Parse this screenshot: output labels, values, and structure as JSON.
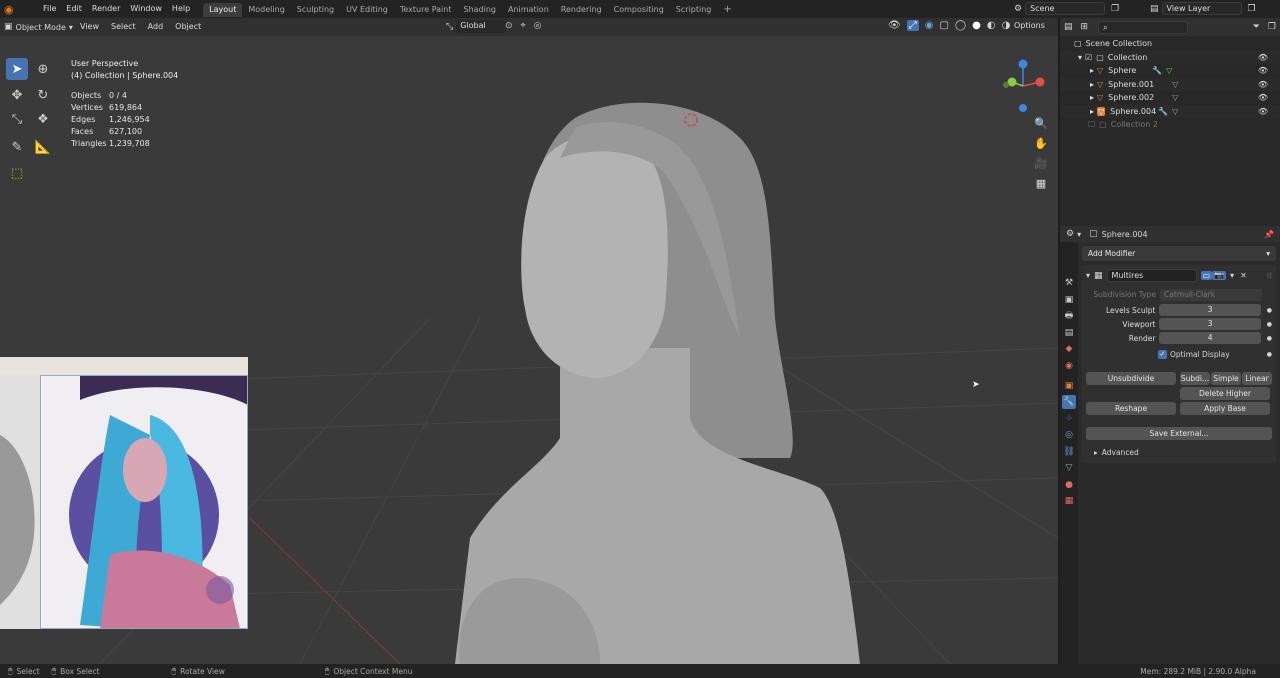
{
  "topbar": {
    "menus": [
      "File",
      "Edit",
      "Render",
      "Window",
      "Help"
    ],
    "workspaces": [
      "Layout",
      "Modeling",
      "Sculpting",
      "UV Editing",
      "Texture Paint",
      "Shading",
      "Animation",
      "Rendering",
      "Compositing",
      "Scripting"
    ],
    "active_workspace": "Layout",
    "add_tab": "+",
    "scene": "Scene",
    "view_layer": "View Layer"
  },
  "viewport": {
    "mode": "Object Mode",
    "menus": [
      "View",
      "Select",
      "Add",
      "Object"
    ],
    "orientation": "Global",
    "options": "Options",
    "perspective": "User Perspective",
    "collection_info": "(4) Collection | Sphere.004",
    "stats": [
      {
        "label": "Objects",
        "value": "0 / 4"
      },
      {
        "label": "Vertices",
        "value": "619,864"
      },
      {
        "label": "Edges",
        "value": "1,246,954"
      },
      {
        "label": "Faces",
        "value": "627,100"
      },
      {
        "label": "Triangles",
        "value": "1,239,708"
      }
    ],
    "gizmo_axes": {
      "x": "#e84a4a",
      "y": "#8acb4a",
      "z": "#3f86e0"
    }
  },
  "outliner": {
    "scene_collection": "Scene Collection",
    "collection": "Collection",
    "objects": [
      "Sphere",
      "Sphere.001",
      "Sphere.002",
      "Sphere.004"
    ],
    "collection2": "Collection 2"
  },
  "properties": {
    "object_name": "Sphere.004",
    "add_modifier": "Add Modifier",
    "modifier_name": "Multires",
    "subdivision_type_label": "Subdivision Type",
    "subdivision_type_value": "Catmull-Clark",
    "levels_sculpt_label": "Levels Sculpt",
    "levels_sculpt": "3",
    "viewport_label": "Viewport",
    "viewport": "3",
    "render_label": "Render",
    "render": "4",
    "optimal_display": "Optimal Display",
    "unsubdivide": "Unsubdivide",
    "subdivide": "Subdi...",
    "simple": "Simple",
    "linear": "Linear",
    "delete_higher": "Delete Higher",
    "reshape": "Reshape",
    "apply_base": "Apply Base",
    "save_external": "Save External...",
    "advanced": "Advanced"
  },
  "statusbar": {
    "select": "Select",
    "box_select": "Box Select",
    "rotate_view": "Rotate View",
    "context_menu": "Object Context Menu",
    "memory": "Mem: 289.2 MiB | 2.90.0 Alpha"
  },
  "colors": {
    "accent": "#4772b3",
    "object_orange": "#e0823a",
    "mesh_green": "#68c466"
  }
}
